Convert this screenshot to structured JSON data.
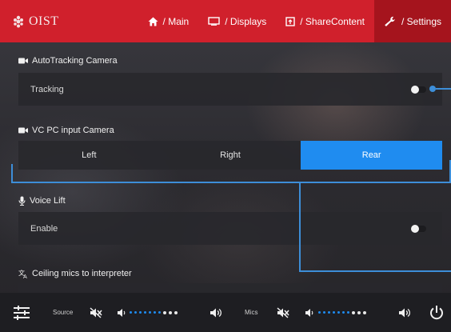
{
  "header": {
    "logo_text": "OIST",
    "tabs": [
      {
        "label": "/ Main",
        "icon": "home-icon",
        "active": false
      },
      {
        "label": "/ Displays",
        "icon": "display-icon",
        "active": false
      },
      {
        "label": "/ ShareContent",
        "icon": "share-content-icon",
        "active": false
      },
      {
        "label": "/ Settings",
        "icon": "wrench-icon",
        "active": true
      }
    ]
  },
  "sections": {
    "autotracking": {
      "title": "AutoTracking Camera",
      "row_label": "Tracking",
      "toggle_on": false
    },
    "vc_input": {
      "title": "VC PC input Camera",
      "options": [
        "Left",
        "Right",
        "Rear"
      ],
      "selected": "Rear"
    },
    "voice_lift": {
      "title": "Voice Lift",
      "row_label": "Enable",
      "toggle_on": false
    },
    "ceiling_mics": {
      "title": "Ceiling mics to interpreter"
    }
  },
  "footer": {
    "source_label": "Source",
    "mics_label": "Mics",
    "source_level": 0.7,
    "mics_level": 0.7
  },
  "colors": {
    "header": "#d0202c",
    "active_tab": "#a5141d",
    "accent": "#1f8cf0",
    "callout": "#3d8ed8"
  }
}
